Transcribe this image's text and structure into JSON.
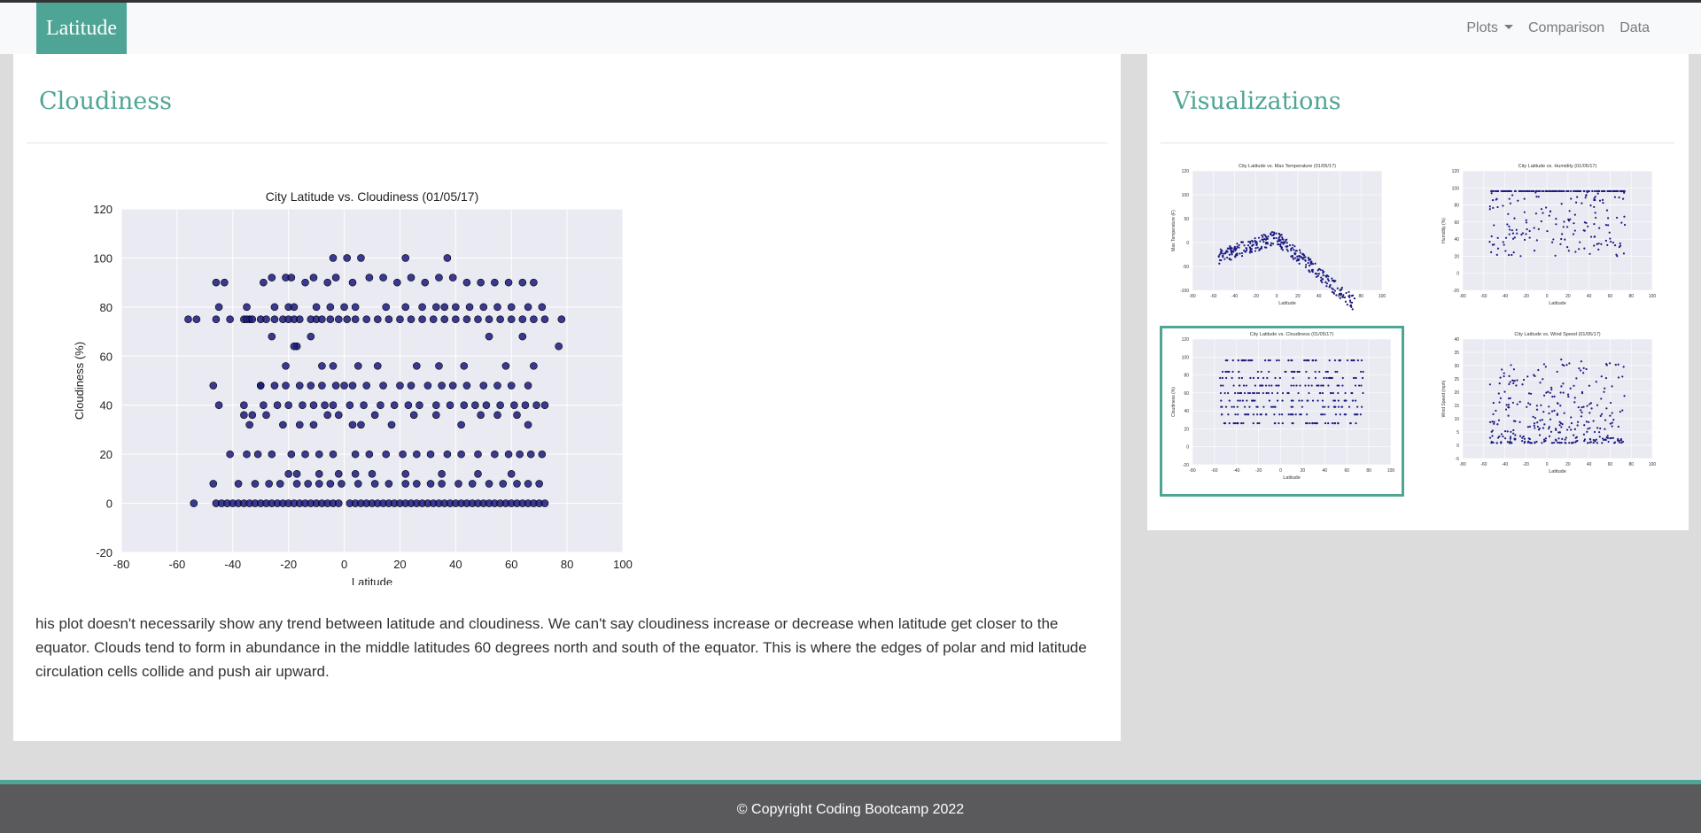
{
  "nav": {
    "brand": "Latitude",
    "plots_label": "Plots",
    "comparison_label": "Comparison",
    "data_label": "Data"
  },
  "main": {
    "heading": "Cloudiness",
    "description": "his plot doesn't necessarily show any trend between latitude and cloudiness. We can't say cloudiness increase or decrease when latitude get closer to the equator. Clouds tend to form in abundance in the middle latitudes 60 degrees north and south of the equator. This is where the edges of polar and mid latitude circulation cells collide and push air upward."
  },
  "sidebar": {
    "heading": "Visualizations",
    "thumbs": [
      {
        "title": "City Latitude vs. Max Temperature (01/05/17)",
        "ylabel": "Max Temperature (F)",
        "xlabel": "Latitude",
        "yticks": [
          "120",
          "100",
          "50",
          "0",
          "-50",
          "-100"
        ]
      },
      {
        "title": "City Latitude vs. Humidity (01/05/17)",
        "ylabel": "Humidity (%)",
        "xlabel": "Latitude",
        "yticks": [
          "120",
          "100",
          "80",
          "60",
          "40",
          "20",
          "0",
          "-20"
        ]
      },
      {
        "title": "City Latitude vs. Cloudiness (01/05/17)",
        "ylabel": "Cloudiness (%)",
        "xlabel": "Latitude",
        "yticks": [
          "120",
          "100",
          "80",
          "60",
          "40",
          "20",
          "0",
          "-20"
        ]
      },
      {
        "title": "City Latitude vs. Wind Speed (01/05/17)",
        "ylabel": "Wind Speed (mph)",
        "xlabel": "Latitude",
        "yticks": [
          "40",
          "35",
          "30",
          "25",
          "20",
          "15",
          "10",
          "5",
          "0",
          "-5"
        ]
      }
    ],
    "thumb_xticks": [
      "-80",
      "-60",
      "-40",
      "-20",
      "0",
      "20",
      "40",
      "60",
      "80",
      "100"
    ]
  },
  "footer": {
    "copyright": "© Copyright Coding Bootcamp 2022"
  },
  "colors": {
    "accent": "#4fa595",
    "marker": "#1a1a80",
    "plot_bg": "#eaeaf2"
  },
  "chart_data": {
    "type": "scatter",
    "title": "City Latitude vs. Cloudiness (01/05/17)",
    "xlabel": "Latitude",
    "ylabel": "Cloudiness (%)",
    "xlim": [
      -80,
      100
    ],
    "ylim": [
      -20,
      120
    ],
    "xticks": [
      -80,
      -60,
      -40,
      -20,
      0,
      20,
      40,
      60,
      80,
      100
    ],
    "yticks": [
      -20,
      0,
      20,
      40,
      60,
      80,
      100,
      120
    ],
    "grid": true,
    "x": [
      -54,
      -46,
      -44,
      -42,
      -40,
      -38,
      -36,
      -34,
      -32,
      -30,
      -28,
      -26,
      -24,
      -22,
      -20,
      -18,
      -16,
      -14,
      -12,
      -10,
      -8,
      -6,
      -4,
      -2,
      2,
      4,
      6,
      8,
      10,
      12,
      14,
      16,
      18,
      20,
      22,
      24,
      26,
      28,
      30,
      32,
      34,
      36,
      38,
      40,
      42,
      44,
      46,
      48,
      50,
      52,
      54,
      56,
      58,
      60,
      62,
      64,
      66,
      68,
      70,
      72,
      -56,
      -53,
      -46,
      -41,
      -36,
      -34,
      -30,
      -28,
      -25,
      -22,
      -20,
      -18,
      -16,
      -12,
      -10,
      -8,
      -5,
      -2,
      1,
      4,
      8,
      12,
      16,
      20,
      24,
      28,
      32,
      36,
      40,
      44,
      48,
      52,
      56,
      60,
      64,
      68,
      72,
      78,
      -35,
      -33,
      -29,
      -26,
      -21,
      -19,
      -14,
      -11,
      -6,
      -3,
      3,
      9,
      14,
      19,
      24,
      29,
      34,
      39,
      44,
      49,
      54,
      59,
      64,
      68,
      -46,
      -43,
      -32,
      -27,
      -23,
      -17,
      -13,
      -9,
      -5,
      -1,
      5,
      11,
      16,
      22,
      26,
      31,
      35,
      41,
      46,
      52,
      57,
      62,
      66,
      70,
      -47,
      -38,
      -33,
      -29,
      -24,
      -20,
      -15,
      -11,
      -7,
      -4,
      2,
      7,
      13,
      18,
      23,
      27,
      33,
      38,
      43,
      47,
      51,
      56,
      61,
      65,
      69,
      72,
      -45,
      -36,
      -31,
      -26,
      -19,
      -14,
      -9,
      -4,
      4,
      9,
      15,
      21,
      26,
      31,
      37,
      42,
      48,
      54,
      59,
      63,
      67,
      71,
      -41,
      -35,
      -30,
      -25,
      -21,
      -16,
      -12,
      -8,
      -3,
      0,
      3,
      8,
      14,
      20,
      24,
      30,
      35,
      39,
      44,
      50,
      55,
      60,
      66,
      -47,
      -30,
      -25,
      -20,
      -18,
      -10,
      -5,
      0,
      4,
      15,
      22,
      28,
      33,
      36,
      40,
      45,
      50,
      55,
      60,
      66,
      71,
      -45,
      -35,
      -28,
      -22,
      -16,
      -11,
      -6,
      -2,
      3,
      6,
      11,
      17,
      25,
      33,
      42,
      49,
      55,
      62,
      66,
      -36,
      -34,
      -26,
      -17,
      -12,
      -8,
      -4,
      5,
      12,
      26,
      34,
      43,
      52,
      58,
      64,
      68,
      77,
      -21,
      -18,
      -9,
      -2,
      4,
      10,
      22,
      35,
      48,
      60,
      -20,
      -17,
      -4,
      1,
      6,
      22,
      37
    ],
    "y": [
      0,
      0,
      0,
      0,
      0,
      0,
      0,
      0,
      0,
      0,
      0,
      0,
      0,
      0,
      0,
      0,
      0,
      0,
      0,
      0,
      0,
      0,
      0,
      0,
      0,
      0,
      0,
      0,
      0,
      0,
      0,
      0,
      0,
      0,
      0,
      0,
      0,
      0,
      0,
      0,
      0,
      0,
      0,
      0,
      0,
      0,
      0,
      0,
      0,
      0,
      0,
      0,
      0,
      0,
      0,
      0,
      0,
      0,
      0,
      0,
      75,
      75,
      75,
      75,
      75,
      75,
      75,
      75,
      75,
      75,
      75,
      75,
      75,
      75,
      75,
      75,
      75,
      75,
      75,
      75,
      75,
      75,
      75,
      75,
      75,
      75,
      75,
      75,
      75,
      75,
      75,
      75,
      75,
      75,
      75,
      75,
      75,
      75,
      75,
      75,
      90,
      92,
      92,
      92,
      90,
      92,
      90,
      92,
      90,
      92,
      92,
      90,
      92,
      90,
      92,
      92,
      90,
      90,
      90,
      90,
      90,
      90,
      90,
      90,
      8,
      8,
      8,
      8,
      8,
      8,
      8,
      8,
      8,
      8,
      8,
      8,
      8,
      8,
      8,
      8,
      8,
      8,
      8,
      8,
      8,
      8,
      8,
      8,
      36,
      40,
      40,
      40,
      40,
      40,
      40,
      40,
      40,
      40,
      40,
      40,
      40,
      40,
      40,
      40,
      40,
      40,
      40,
      40,
      40,
      40,
      40,
      40,
      40,
      40,
      20,
      20,
      20,
      20,
      20,
      20,
      20,
      20,
      20,
      20,
      20,
      20,
      20,
      20,
      20,
      20,
      20,
      20,
      20,
      20,
      20,
      20,
      48,
      48,
      48,
      48,
      48,
      48,
      48,
      48,
      48,
      48,
      48,
      48,
      48,
      48,
      48,
      48,
      48,
      48,
      48,
      48,
      48,
      48,
      48,
      80,
      80,
      80,
      80,
      80,
      80,
      80,
      80,
      80,
      80,
      80,
      80,
      80,
      80,
      80,
      80,
      80,
      80,
      80,
      80,
      80,
      36,
      32,
      32,
      32,
      36,
      36,
      32,
      32,
      36,
      32,
      36,
      36,
      32,
      36,
      36,
      36,
      32,
      36,
      32,
      68,
      64,
      68,
      56,
      56,
      56,
      56,
      56,
      56,
      56,
      68,
      56,
      68,
      56,
      64,
      56,
      64,
      12,
      12,
      12,
      12,
      12,
      12,
      12,
      12,
      12,
      12,
      100,
      100,
      100,
      100,
      100,
      100,
      100
    ]
  }
}
